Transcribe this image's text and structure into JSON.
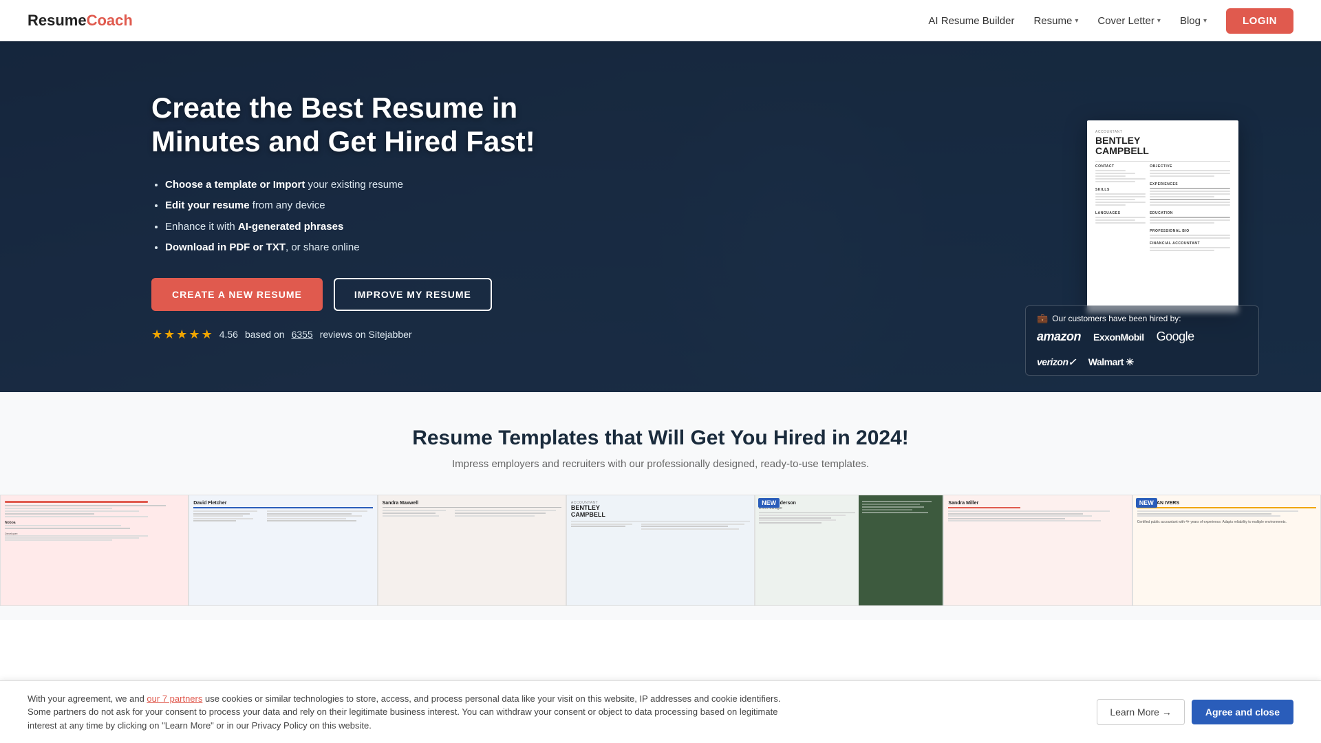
{
  "brand": {
    "name_part1": "Resume",
    "name_part2": "Coach"
  },
  "navbar": {
    "links": [
      {
        "id": "ai-builder",
        "label": "AI Resume Builder",
        "has_dropdown": false
      },
      {
        "id": "resume",
        "label": "Resume",
        "has_dropdown": true
      },
      {
        "id": "cover-letter",
        "label": "Cover Letter",
        "has_dropdown": true
      },
      {
        "id": "blog",
        "label": "Blog",
        "has_dropdown": true
      }
    ],
    "login_label": "LOGIN"
  },
  "hero": {
    "title": "Create the Best Resume in Minutes and Get Hired Fast!",
    "bullets": [
      {
        "prefix": "Choose a template or Import",
        "suffix": " your existing resume"
      },
      {
        "prefix": "Edit your resume",
        "suffix": " from any device"
      },
      {
        "prefix": "Enhance it with ",
        "bold": "AI-generated phrases"
      },
      {
        "prefix": "Download in PDF or TXT",
        "suffix": ", or share online"
      }
    ],
    "cta_create": "CREATE A NEW RESUME",
    "cta_improve": "IMPROVE MY RESUME",
    "rating_score": "4.56",
    "rating_based": "based on",
    "rating_count": "6355",
    "rating_site": "reviews on Sitejabber"
  },
  "resume_card": {
    "label": "ACCOUNTANT",
    "name_line1": "BENTLEY",
    "name_line2": "CAMPBELL",
    "sections": [
      "CONTACT",
      "OBJECTIVE",
      "EXPERIENCES",
      "SKILLS",
      "LANGUAGES",
      "EDUCATION",
      "PROFESSIONAL BIO",
      "FINANCIAL ACCOUNTANT"
    ]
  },
  "hired_by": {
    "title": "Our customers have been hired by:",
    "companies": [
      "amazon",
      "ExxonMobil",
      "Google",
      "verizon✓",
      "Walmart ✳"
    ]
  },
  "templates_section": {
    "title": "Resume Templates that Will Get You Hired in 2024!",
    "subtitle": "Impress employers and recruiters with our professionally designed, ready-to-use templates.",
    "templates": [
      {
        "id": "t1",
        "name": "",
        "is_new": false,
        "color": "#e8edf2"
      },
      {
        "id": "t2",
        "name": "David Fletcher",
        "is_new": false,
        "color": "#f0f4f8"
      },
      {
        "id": "t3",
        "name": "Sandra Maxwell",
        "is_new": false,
        "color": "#f5f0ed"
      },
      {
        "id": "t4",
        "name": "Bentley Campbell",
        "is_new": false,
        "color": "#eef3f8"
      },
      {
        "id": "t5",
        "name": "Chloe Anderson",
        "is_new": true,
        "color": "#edf2ee"
      },
      {
        "id": "t6",
        "name": "Sandra Miller",
        "is_new": false,
        "color": "#fdf0ee"
      },
      {
        "id": "t7",
        "name": "Jonathan Ivers",
        "is_new": true,
        "color": "#fff8f0"
      }
    ]
  },
  "cookie_banner": {
    "text_before_link": "With your agreement, we and ",
    "link_text": "our 7 partners",
    "text_after": " use cookies or similar technologies to store, access, and process personal data like your visit on this website, IP addresses and cookie identifiers. Some partners do not ask for your consent to process your data and rely on their legitimate business interest. You can withdraw your consent or object to data processing based on legitimate interest at any time by clicking on \"Learn More\" or in our Privacy Policy on this website.",
    "learn_more_label": "Learn More →",
    "agree_label": "Agree and close"
  }
}
